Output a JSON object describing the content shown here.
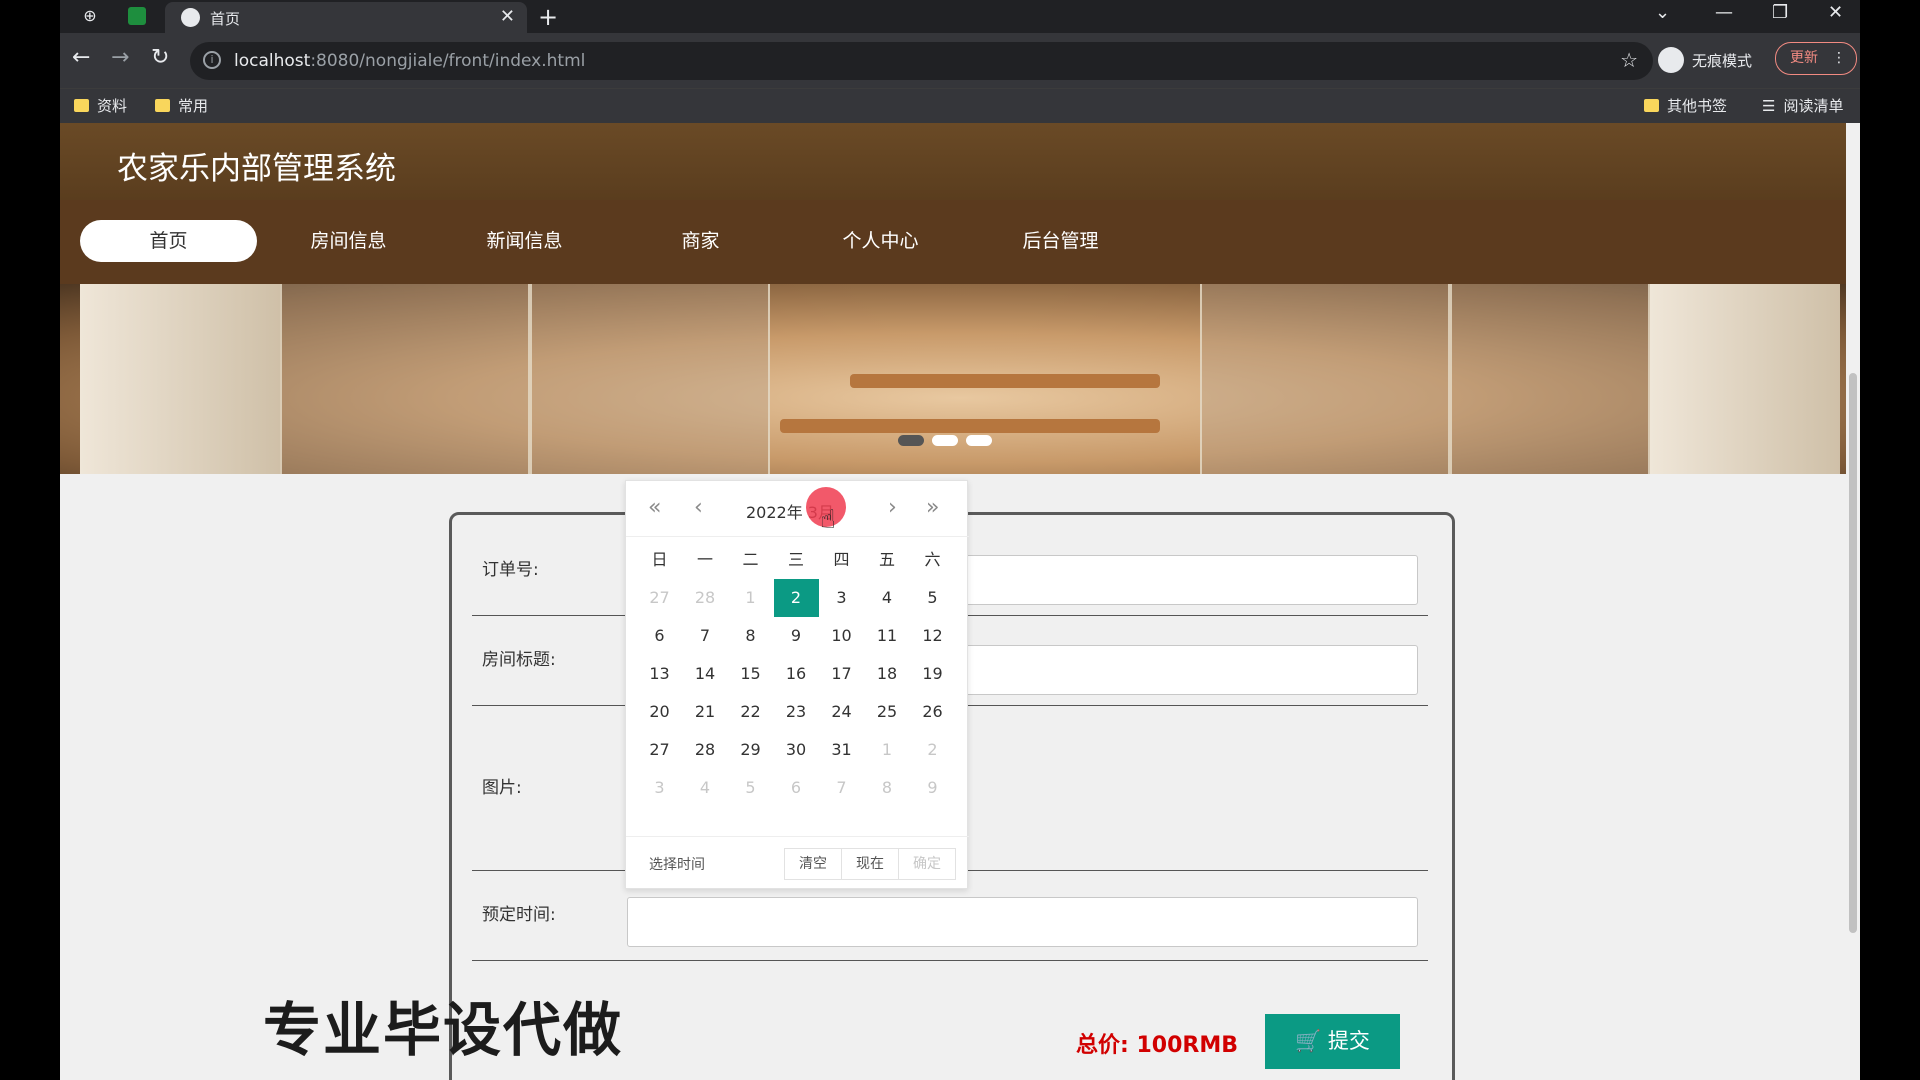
{
  "browser": {
    "tab_title": "首页",
    "url_host": "localhost",
    "url_rest": ":8080/nongjiale/front/index.html",
    "incognito_label": "无痕模式",
    "update_label": "更新",
    "bookmarks": [
      "资料",
      "常用"
    ],
    "bookmarks_right": [
      "其他书签",
      "阅读清单"
    ]
  },
  "site": {
    "title": "农家乐内部管理系统",
    "nav": [
      "首页",
      "房间信息",
      "新闻信息",
      "商家",
      "个人中心",
      "后台管理"
    ]
  },
  "form": {
    "order_label": "订单号:",
    "room_title_label": "房间标题:",
    "image_label": "图片:",
    "booking_time_label": "预定时间:",
    "total_label": "总价: 100RMB",
    "submit_label": "提交"
  },
  "watermark": "专业毕设代做",
  "datepicker": {
    "title": "2022年  3月",
    "weekdays": [
      "日",
      "一",
      "二",
      "三",
      "四",
      "五",
      "六"
    ],
    "days": [
      [
        "27",
        "28",
        "1",
        "2",
        "3",
        "4",
        "5"
      ],
      [
        "6",
        "7",
        "8",
        "9",
        "10",
        "11",
        "12"
      ],
      [
        "13",
        "14",
        "15",
        "16",
        "17",
        "18",
        "19"
      ],
      [
        "20",
        "21",
        "22",
        "23",
        "24",
        "25",
        "26"
      ],
      [
        "27",
        "28",
        "29",
        "30",
        "31",
        "1",
        "2"
      ],
      [
        "3",
        "4",
        "5",
        "6",
        "7",
        "8",
        "9"
      ]
    ],
    "select_time": "选择时间",
    "clear": "清空",
    "now": "现在",
    "confirm": "确定"
  }
}
